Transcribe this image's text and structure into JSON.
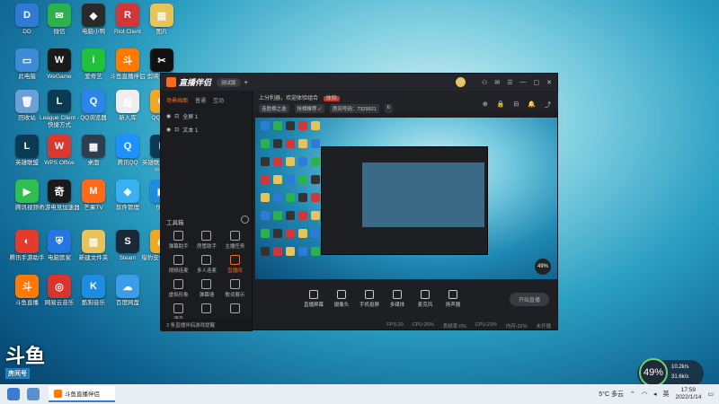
{
  "desktop": {
    "icons": [
      {
        "label": "DD",
        "color": "#2e7bd6",
        "glyph": "D"
      },
      {
        "label": "微信",
        "color": "#2bb24c",
        "glyph": "✉"
      },
      {
        "label": "电脑小鸭",
        "color": "#2a2a2a",
        "glyph": "◆"
      },
      {
        "label": "Riot Client",
        "color": "#d13639",
        "glyph": "R"
      },
      {
        "label": "图片",
        "color": "#e8c35a",
        "glyph": "▤"
      },
      {
        "label": "此电脑",
        "color": "#3b8bd6",
        "glyph": "▭"
      },
      {
        "label": "WeGame",
        "color": "#1a1a1a",
        "glyph": "W"
      },
      {
        "label": "爱奇艺",
        "color": "#1fc23b",
        "glyph": "i"
      },
      {
        "label": "斗鱼直播伴侣",
        "color": "#ff7a00",
        "glyph": "斗"
      },
      {
        "label": "剪映专业版",
        "color": "#111111",
        "glyph": "✂"
      },
      {
        "label": "回收站",
        "color": "#6aa0d8",
        "glyph": "🗑"
      },
      {
        "label": "League Client - 快捷方式",
        "color": "#0a3b52",
        "glyph": "L"
      },
      {
        "label": "QQ浏览器",
        "color": "#2a86e8",
        "glyph": "Q"
      },
      {
        "label": "新入库",
        "color": "#eeeeee",
        "glyph": "▥"
      },
      {
        "label": "QQ游戏",
        "color": "#f0a81f",
        "glyph": "Q"
      },
      {
        "label": "英雄联盟",
        "color": "#0a3b52",
        "glyph": "L"
      },
      {
        "label": "WPS Office",
        "color": "#d93a30",
        "glyph": "W"
      },
      {
        "label": "桌面",
        "color": "#2c3e50",
        "glyph": "▦"
      },
      {
        "label": "腾讯QQ",
        "color": "#1e90ff",
        "glyph": "Q"
      },
      {
        "label": "英雄联盟WeGame版",
        "color": "#0a3b52",
        "glyph": "L"
      },
      {
        "label": "腾讯视频",
        "color": "#2fbf4f",
        "glyph": "▶"
      },
      {
        "label": "奇游电竞加速器",
        "color": "#1a1a1a",
        "glyph": "奇"
      },
      {
        "label": "芒果TV",
        "color": "#ff6a1a",
        "glyph": "M"
      },
      {
        "label": "软件管理",
        "color": "#3ab0f0",
        "glyph": "◈"
      },
      {
        "label": "优酷",
        "color": "#1e8de0",
        "glyph": "▶"
      },
      {
        "label": "腾讯手游助手",
        "color": "#e33b2e",
        "glyph": "◐"
      },
      {
        "label": "电脑管家",
        "color": "#2476e0",
        "glyph": "⛨"
      },
      {
        "label": "新建文件夹",
        "color": "#e8c35a",
        "glyph": "▥"
      },
      {
        "label": "Steam",
        "color": "#1b2838",
        "glyph": "S"
      },
      {
        "label": "猎豹安全浏览器",
        "color": "#f0a81f",
        "glyph": "◉"
      },
      {
        "label": "斗鱼直播",
        "color": "#ff7a00",
        "glyph": "斗"
      },
      {
        "label": "网易云音乐",
        "color": "#d8332c",
        "glyph": "◎"
      },
      {
        "label": "酷狗音乐",
        "color": "#1e8de0",
        "glyph": "K"
      },
      {
        "label": "百度网盘",
        "color": "#3b9ce8",
        "glyph": "☁"
      }
    ]
  },
  "app": {
    "title": "直播伴侣",
    "edition": "测试版",
    "plus": "+",
    "avatar": "斗",
    "window_controls": [
      "⚇",
      "✉",
      "☰",
      "—",
      "▢",
      "✕"
    ],
    "tabs": [
      "场景画面",
      "普通",
      "互动"
    ],
    "tab_active": 0,
    "scenes": [
      {
        "label": "全屏 1"
      },
      {
        "label": "文本 1"
      }
    ],
    "tools_title": "工具箱",
    "tools": [
      {
        "label": "弹幕助手",
        "hot": false
      },
      {
        "label": "房管助手",
        "hot": false
      },
      {
        "label": "主播任务",
        "hot": false
      },
      {
        "label": "视频连麦",
        "hot": false
      },
      {
        "label": "多人连麦",
        "hot": false
      },
      {
        "label": "直播间",
        "hot": true
      },
      {
        "label": "虚拟形象",
        "hot": false
      },
      {
        "label": "弹幕墙",
        "hot": false
      },
      {
        "label": "歌词展示",
        "hot": false
      },
      {
        "label": "语音",
        "hot": false
      },
      {
        "label": "",
        "hot": false
      },
      {
        "label": "",
        "hot": false
      }
    ],
    "left_bottom": "3 条直播伴侣游戏提醒",
    "notice": "上分利器，欢迎体验组合",
    "notice_btn": "体验",
    "chips": [
      "连胜榜之选",
      "抢榜推荐 ✓",
      "房间号码：7329921",
      "6"
    ],
    "right_icons": [
      "⊕",
      "🔒",
      "⊟",
      "🔔",
      "⤴"
    ],
    "preview_badge": "49%",
    "controls": [
      "直播屏幕",
      "摄像头",
      "手机投屏",
      "多媒体",
      "麦克风",
      "扬声器"
    ],
    "start_button": "开始直播",
    "status": [
      "FPS:30",
      "CPU:26%",
      "丢帧率:0%",
      "CPU:23%",
      "内存:32%",
      "未开播"
    ]
  },
  "watermark": {
    "big": "斗鱼",
    "small": "房间号"
  },
  "gauge": {
    "percent": "49%",
    "up": "10.2k/s",
    "down": "31.6k/s"
  },
  "taskbar": {
    "app_label": "斗鱼直播伴侣",
    "weather": "5°C 多云",
    "ime": "英",
    "time": "17:59",
    "date": "2022/1/14"
  }
}
